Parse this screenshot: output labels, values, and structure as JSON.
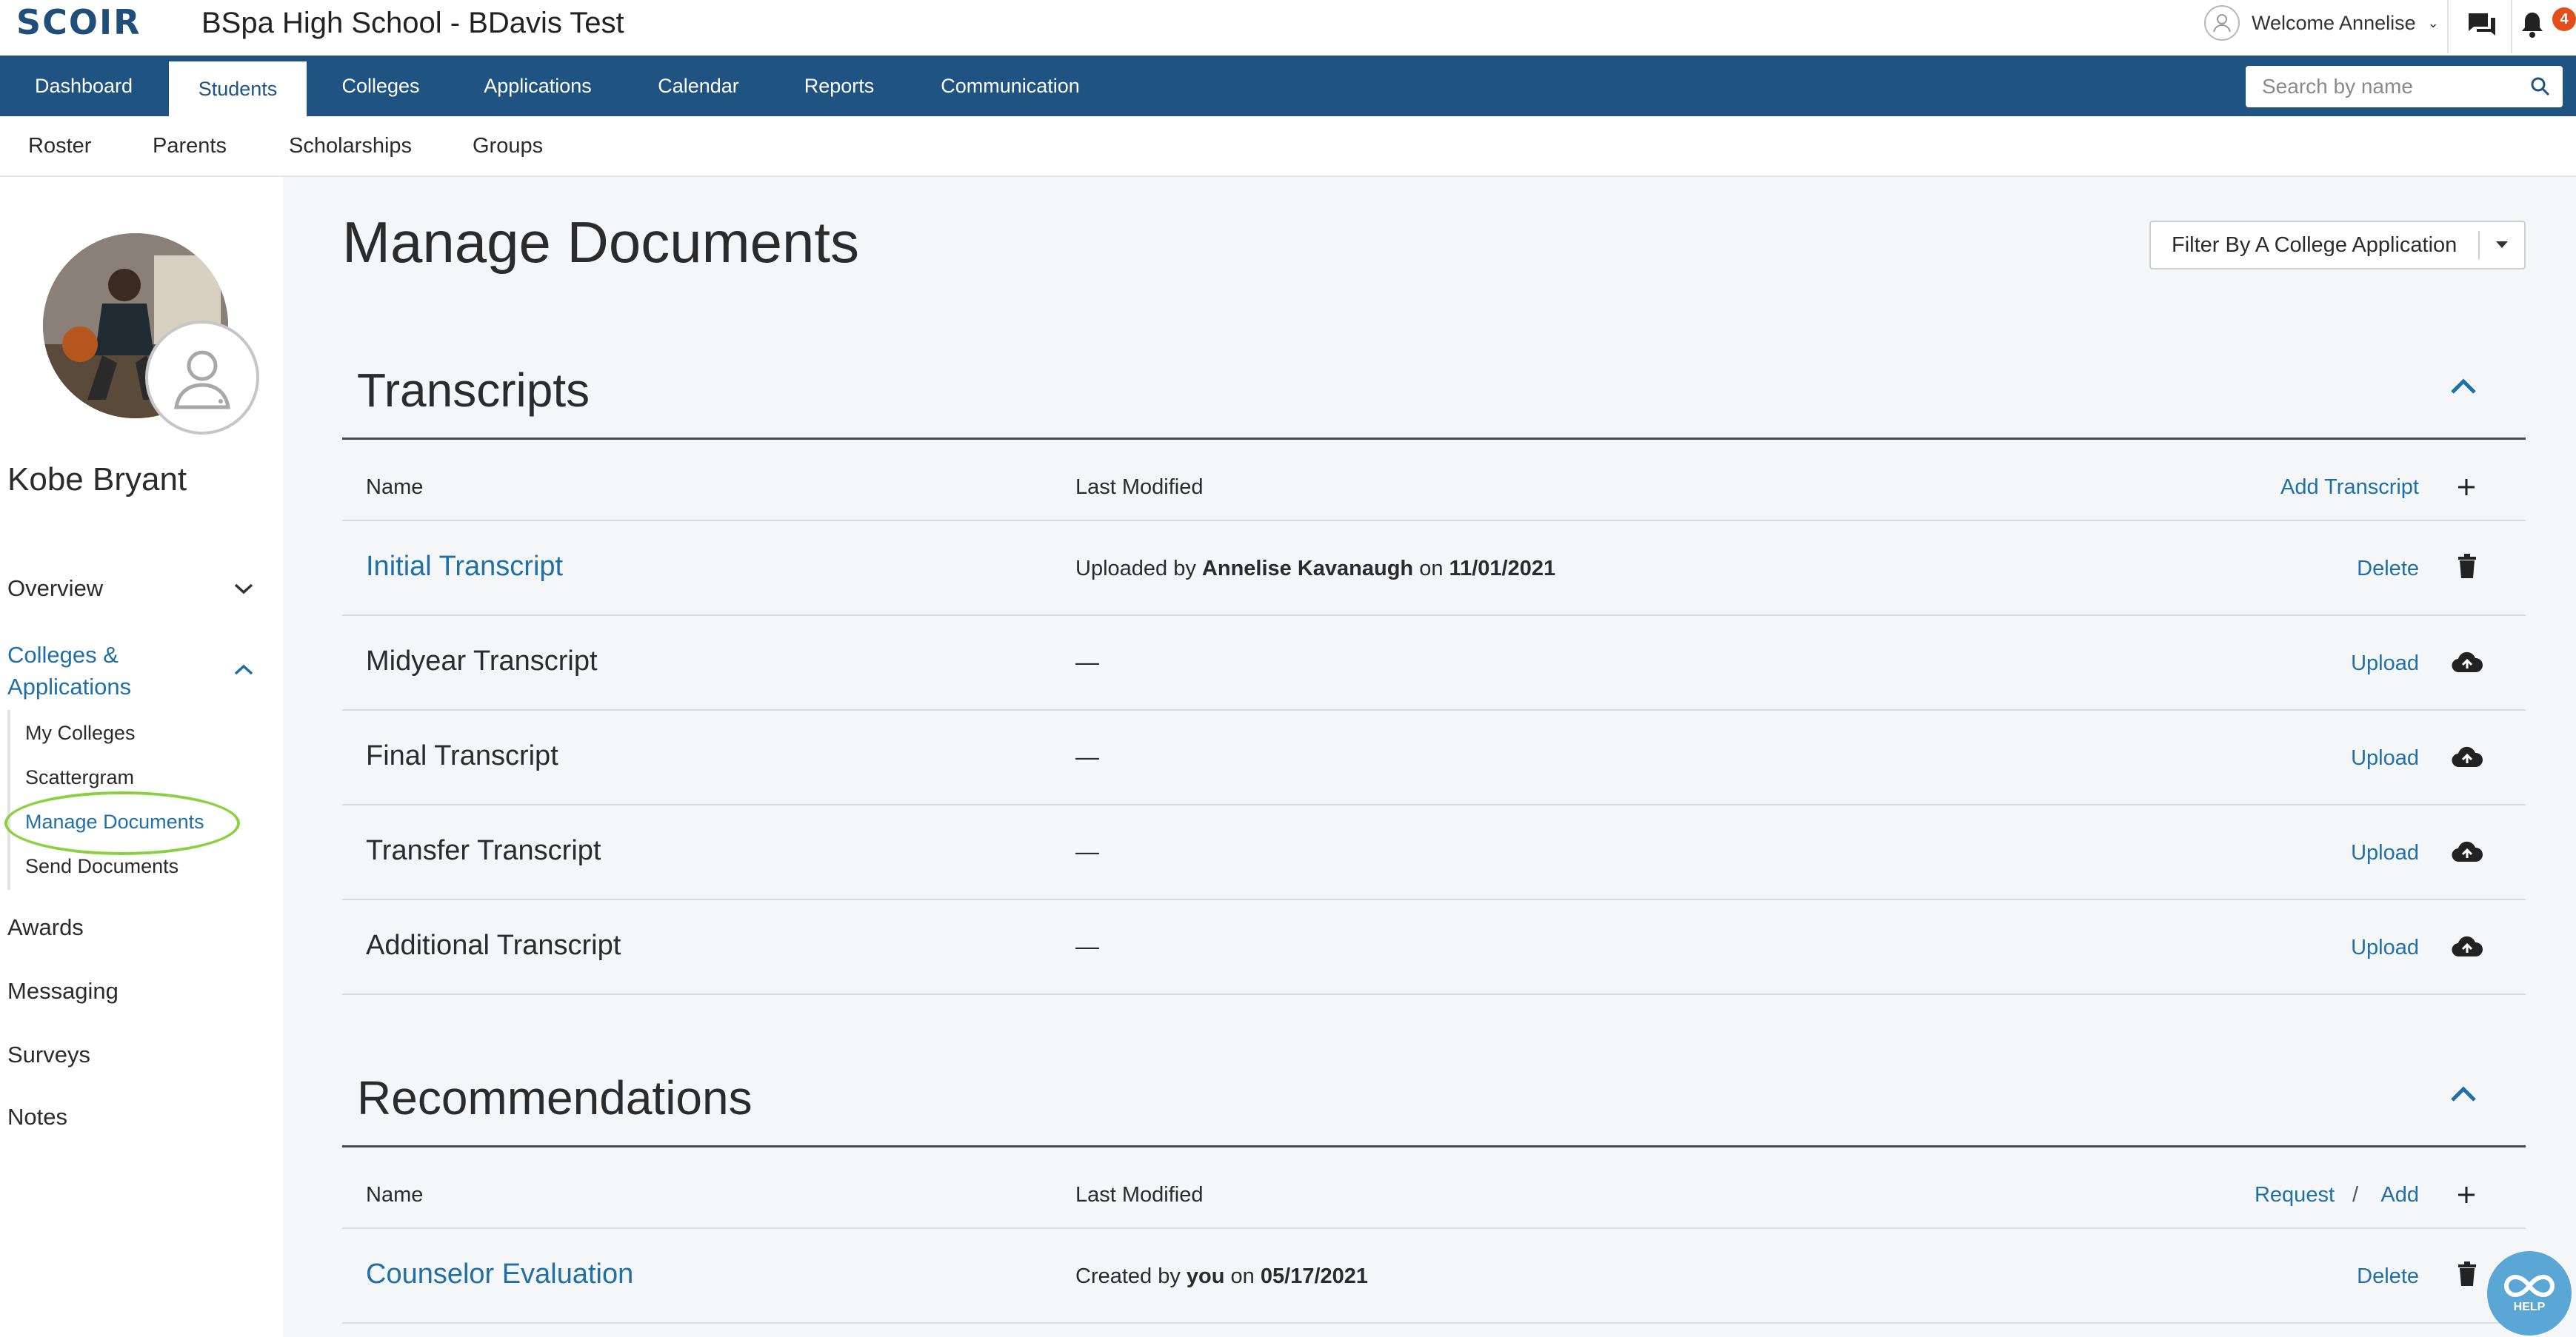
{
  "header": {
    "logo_text": "SCOIR",
    "school_title": "BSpa High School - BDavis Test",
    "welcome_text": "Welcome Annelise",
    "notification_count": "4",
    "icons": [
      "user-avatar-icon",
      "chevron-down-icon",
      "chat-icon",
      "bell-icon"
    ]
  },
  "nav": {
    "tabs": [
      {
        "label": "Dashboard",
        "active": false
      },
      {
        "label": "Students",
        "active": true
      },
      {
        "label": "Colleges",
        "active": false
      },
      {
        "label": "Applications",
        "active": false
      },
      {
        "label": "Calendar",
        "active": false
      },
      {
        "label": "Reports",
        "active": false
      },
      {
        "label": "Communication",
        "active": false
      }
    ],
    "search_placeholder": "Search by name"
  },
  "subnav": {
    "items": [
      "Roster",
      "Parents",
      "Scholarships",
      "Groups"
    ]
  },
  "sidebar": {
    "student_name": "Kobe Bryant",
    "overview": "Overview",
    "colleges_applications": "Colleges & Applications",
    "sub_items": [
      "My Colleges",
      "Scattergram",
      "Manage Documents",
      "Send Documents"
    ],
    "active_sub_item": "Manage Documents",
    "awards": "Awards",
    "messaging": "Messaging",
    "surveys": "Surveys",
    "notes": "Notes"
  },
  "main": {
    "title": "Manage Documents",
    "filter_label": "Filter By A College Application",
    "transcripts": {
      "title": "Transcripts",
      "col_name": "Name",
      "col_modified": "Last Modified",
      "add_label": "Add Transcript",
      "rows": [
        {
          "name": "Initial Transcript",
          "modified_prefix": "Uploaded by",
          "modified_user": "Annelise Kavanaugh",
          "modified_on": "on",
          "modified_date": "11/01/2021",
          "action": "Delete",
          "icon": "trash-icon"
        },
        {
          "name": "Midyear Transcript",
          "modified": "—",
          "action": "Upload",
          "icon": "cloud-upload-icon"
        },
        {
          "name": "Final Transcript",
          "modified": "—",
          "action": "Upload",
          "icon": "cloud-upload-icon"
        },
        {
          "name": "Transfer Transcript",
          "modified": "—",
          "action": "Upload",
          "icon": "cloud-upload-icon"
        },
        {
          "name": "Additional Transcript",
          "modified": "—",
          "action": "Upload",
          "icon": "cloud-upload-icon"
        }
      ]
    },
    "recommendations": {
      "title": "Recommendations",
      "col_name": "Name",
      "col_modified": "Last Modified",
      "request_label": "Request",
      "slash": "/",
      "add_label": "Add",
      "rows": [
        {
          "name": "Counselor Evaluation",
          "modified_prefix": "Created by",
          "modified_user": "you",
          "modified_on": "on",
          "modified_date": "05/17/2021",
          "action": "Delete",
          "icon": "trash-icon"
        }
      ]
    }
  },
  "help": {
    "label": "HELP"
  },
  "colors": {
    "nav_bg": "#1f5382",
    "link": "#1f6fa8",
    "highlight_ring": "#8ad13f",
    "badge": "#e24e1b",
    "help_bg": "#5aa7d6"
  }
}
